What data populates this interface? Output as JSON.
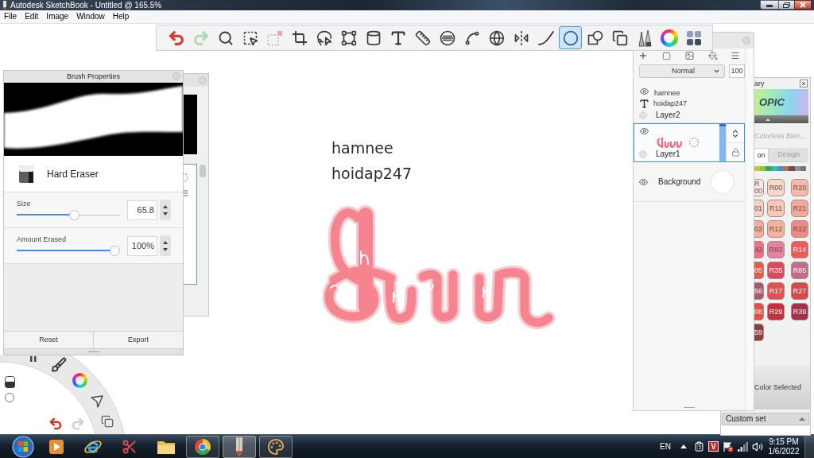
{
  "window": {
    "title": "Autodesk SketchBook - Untitled @ 165.5%"
  },
  "menu": [
    {
      "label": "File"
    },
    {
      "label": "Edit"
    },
    {
      "label": "Image"
    },
    {
      "label": "Window"
    },
    {
      "label": "Help"
    }
  ],
  "toolbar": {
    "tools": [
      {
        "kind": "undo",
        "selected": false,
        "disabled": false
      },
      {
        "kind": "redo",
        "selected": false,
        "disabled": true
      },
      {
        "kind": "zoom",
        "selected": false,
        "disabled": false
      },
      {
        "kind": "select",
        "selected": false,
        "disabled": false
      },
      {
        "kind": "select-alt",
        "selected": false,
        "disabled": true
      },
      {
        "kind": "crop",
        "selected": false,
        "disabled": false
      },
      {
        "kind": "lasso",
        "selected": false,
        "disabled": false
      },
      {
        "kind": "distort",
        "selected": false,
        "disabled": false
      },
      {
        "kind": "fill",
        "selected": false,
        "disabled": false
      },
      {
        "kind": "text",
        "selected": false,
        "disabled": false
      },
      {
        "kind": "ruler",
        "selected": false,
        "disabled": false
      },
      {
        "kind": "ellipse-guide",
        "selected": false,
        "disabled": false
      },
      {
        "kind": "french-curve",
        "selected": false,
        "disabled": false
      },
      {
        "kind": "perspective",
        "selected": false,
        "disabled": false
      },
      {
        "kind": "symmetry",
        "selected": false,
        "disabled": false
      },
      {
        "kind": "steady-stroke",
        "selected": false,
        "disabled": false
      },
      {
        "kind": "ellipse",
        "selected": true,
        "disabled": false
      },
      {
        "kind": "shapes",
        "selected": false,
        "disabled": false
      },
      {
        "kind": "sheets",
        "selected": false,
        "disabled": false
      },
      {
        "kind": "brushes",
        "selected": false,
        "disabled": false
      },
      {
        "kind": "color-wheel",
        "selected": false,
        "disabled": false
      },
      {
        "kind": "swatches",
        "selected": false,
        "disabled": false
      }
    ]
  },
  "brush_properties": {
    "title": "Brush Properties",
    "brush_name": "Hard Eraser",
    "sliders": [
      {
        "label": "Size",
        "level": 0.56,
        "value": "65.8"
      },
      {
        "label": "Amount Erased",
        "level": 1,
        "value": "100%"
      }
    ],
    "buttons": [
      {
        "label": "Reset"
      },
      {
        "label": "Export"
      }
    ]
  },
  "canvas": {
    "texts": [
      "hamnee",
      "hoidap247"
    ]
  },
  "layers": {
    "blend_mode": "Normal",
    "opacity": "100",
    "items": [
      {
        "kind": "text",
        "name": "Layer2",
        "preview_lines": [
          "hamnee",
          "hoidap247"
        ],
        "visible": true,
        "selected": false
      },
      {
        "kind": "paint",
        "name": "Layer1",
        "visible": true,
        "selected": true
      },
      {
        "kind": "background",
        "name": "Background",
        "visible": true,
        "selected": false
      }
    ]
  },
  "copic_library": {
    "title": "ary",
    "logo": "OPIC",
    "set_name": "Colorless Blen...",
    "tabs": [
      {
        "label": "on",
        "selected": true
      },
      {
        "label": "Design",
        "selected": false
      }
    ],
    "hue_strip": [
      {
        "color": "#c9c43a"
      },
      {
        "color": "#8dc63f"
      },
      {
        "color": "#2eae52"
      },
      {
        "color": "#2bbfbf"
      },
      {
        "color": "#4a8fd0"
      },
      {
        "color": "#a07a58"
      },
      {
        "color": "#7a4a3a"
      },
      {
        "color": "#8a9299"
      },
      {
        "color": "#6f777f"
      }
    ],
    "swatches": [
      {
        "label": "R\n00",
        "color": "#f7ece4"
      },
      {
        "label": "R00",
        "color": "#f6d8ca"
      },
      {
        "label": "R20",
        "color": "#f5b9aa"
      },
      {
        "label": "01",
        "color": "#f6d0c0"
      },
      {
        "label": "R11",
        "color": "#f6c9b6"
      },
      {
        "label": "R21",
        "color": "#f3aa9b"
      },
      {
        "label": "02",
        "color": "#f4ae98"
      },
      {
        "label": "R12",
        "color": "#f4b39d"
      },
      {
        "label": "R22",
        "color": "#f08a80"
      },
      {
        "label": "43",
        "color": "#ee6f88"
      },
      {
        "label": "R83",
        "color": "#e584a2"
      },
      {
        "label": "R14",
        "color": "#ee5b56"
      },
      {
        "label": "05",
        "color": "#e95a42"
      },
      {
        "label": "R35",
        "color": "#df4a5b"
      },
      {
        "label": "R85",
        "color": "#c56b8a"
      },
      {
        "label": "56",
        "color": "#a65a70"
      },
      {
        "label": "R17",
        "color": "#e35050"
      },
      {
        "label": "R27",
        "color": "#d64b49"
      },
      {
        "label": "08",
        "color": "#e65040"
      },
      {
        "label": "R29",
        "color": "#c6313d"
      },
      {
        "label": "R39",
        "color": "#a53149"
      },
      {
        "label": "59",
        "color": "#8a4040"
      }
    ],
    "status": "Color Selected",
    "custom_set": "Custom set"
  },
  "taskbar": {
    "apps": [
      {
        "kind": "play",
        "running": false,
        "selected": false
      },
      {
        "kind": "browser-e",
        "running": false,
        "selected": false
      },
      {
        "kind": "scissors",
        "running": false,
        "selected": false
      },
      {
        "kind": "folder",
        "running": false,
        "selected": false
      },
      {
        "kind": "browser-round",
        "running": true,
        "selected": false
      },
      {
        "kind": "pencil",
        "running": true,
        "selected": true
      },
      {
        "kind": "palette",
        "running": true,
        "selected": false
      }
    ],
    "language": "EN",
    "ime": "V",
    "time": "9:15 PM",
    "date": "1/6/2022"
  }
}
